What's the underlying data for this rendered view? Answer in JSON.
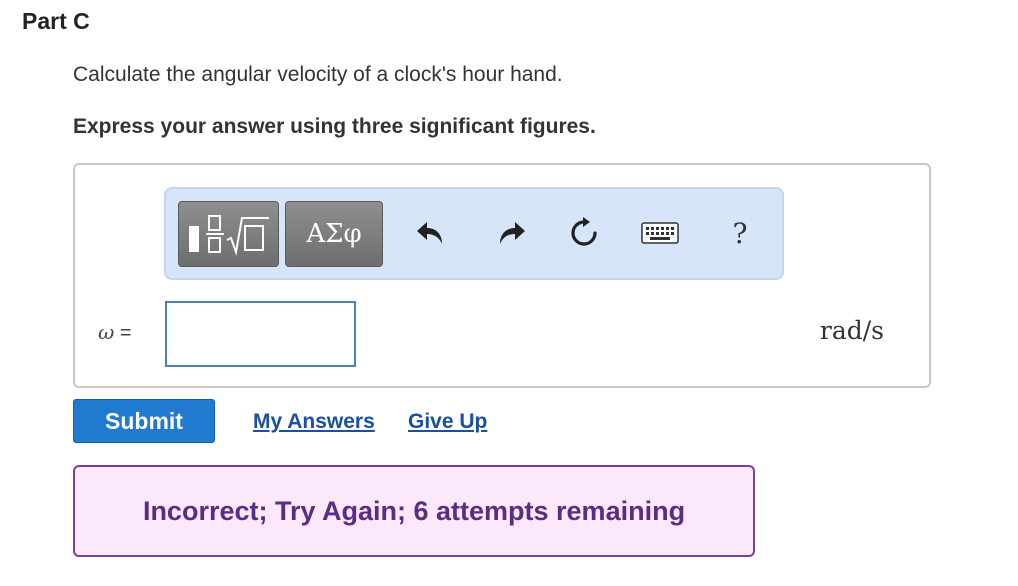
{
  "part": {
    "title": "Part C"
  },
  "question": {
    "text": "Calculate the angular velocity of a clock's hour hand.",
    "instruction": "Express your answer using three significant figures."
  },
  "toolbar": {
    "templates_icon": "fraction-sqrt-template-icon",
    "greek_label": "ΑΣφ",
    "undo_icon": "undo-icon",
    "redo_icon": "redo-icon",
    "reset_icon": "reset-icon",
    "keyboard_icon": "keyboard-icon",
    "help_label": "?"
  },
  "answer": {
    "variable": "ω",
    "equals": "=",
    "value": "",
    "units": "rad/s"
  },
  "actions": {
    "submit_label": "Submit",
    "my_answers_label": "My Answers",
    "give_up_label": "Give Up"
  },
  "feedback": {
    "text": "Incorrect; Try Again; 6 attempts remaining"
  },
  "colors": {
    "submit_bg": "#1f7ad0",
    "link": "#1b4fa3",
    "feedback_bg": "#fbe8fb",
    "feedback_border": "#7b3f9c",
    "feedback_text": "#5b2c83",
    "toolbar_bg": "#d6e6f8",
    "input_border": "#4a7fc1"
  }
}
